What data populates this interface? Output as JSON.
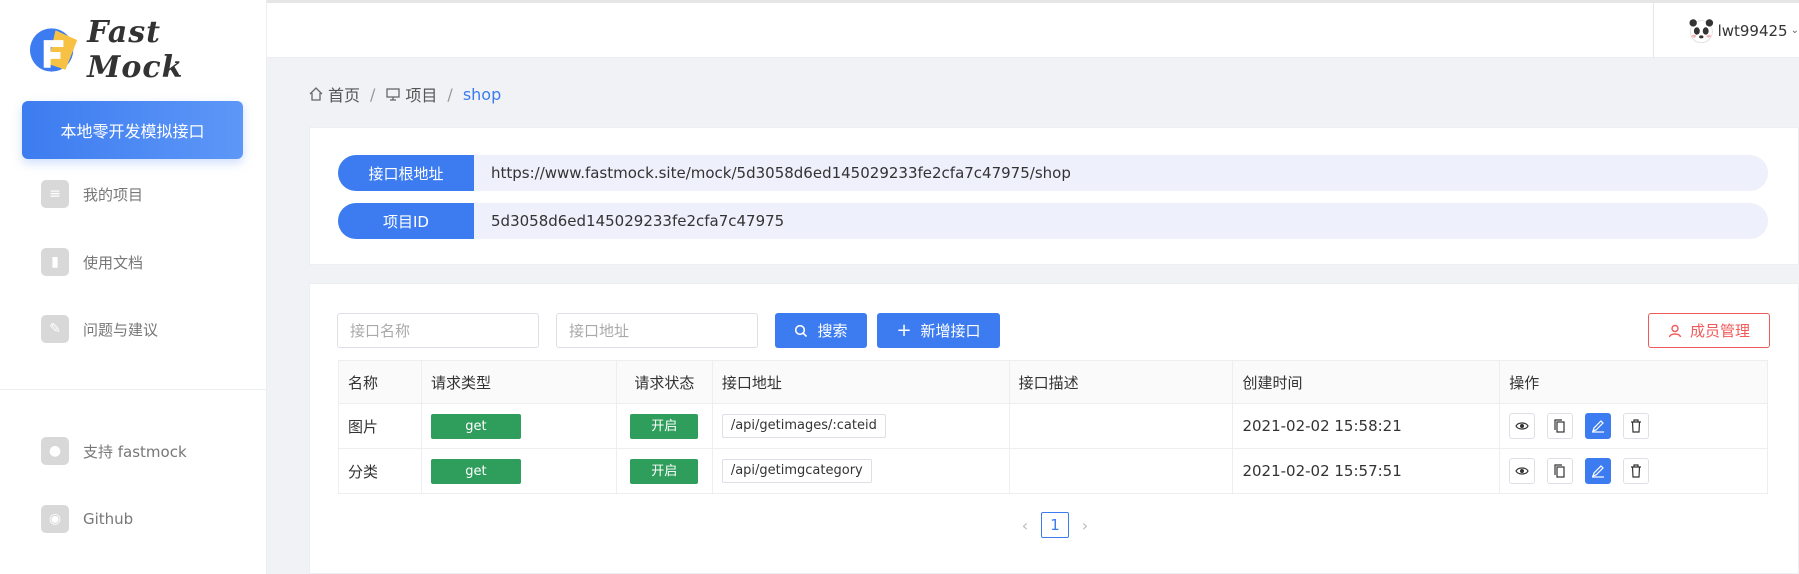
{
  "brand": {
    "name": "Fast Mock"
  },
  "sidebar": {
    "cta": "本地零开发模拟接口",
    "items": [
      {
        "label": "我的项目",
        "icon": "list-icon"
      },
      {
        "label": "使用文档",
        "icon": "book-icon"
      },
      {
        "label": "问题与建议",
        "icon": "edit-note-icon"
      }
    ],
    "bottom_items": [
      {
        "label": "支持 fastmock",
        "icon": "drop-icon"
      },
      {
        "label": "Github",
        "icon": "github-icon"
      }
    ]
  },
  "header": {
    "username": "lwt99425"
  },
  "breadcrumb": {
    "home": "首页",
    "projects": "项目",
    "current": "shop"
  },
  "project": {
    "root_label": "接口根地址",
    "root_url": "https://www.fastmock.site/mock/5d3058d6ed145029233fe2cfa7c47975/shop",
    "id_label": "项目ID",
    "id_value": "5d3058d6ed145029233fe2cfa7c47975"
  },
  "toolbar": {
    "name_placeholder": "接口名称",
    "path_placeholder": "接口地址",
    "search_label": "搜索",
    "add_label": "新增接口",
    "members_label": "成员管理"
  },
  "table": {
    "columns": [
      "名称",
      "请求类型",
      "请求状态",
      "接口地址",
      "接口描述",
      "创建时间",
      "操作"
    ],
    "rows": [
      {
        "name": "图片",
        "method": "get",
        "status": "开启",
        "path": "/api/getimages/:cateid",
        "desc": "",
        "created": "2021-02-02 15:58:21"
      },
      {
        "name": "分类",
        "method": "get",
        "status": "开启",
        "path": "/api/getimgcategory",
        "desc": "",
        "created": "2021-02-02 15:57:51"
      }
    ]
  },
  "pagination": {
    "current": "1"
  },
  "colors": {
    "primary": "#3d7cf0",
    "success": "#2f9e5c",
    "danger": "#f05a5a"
  }
}
